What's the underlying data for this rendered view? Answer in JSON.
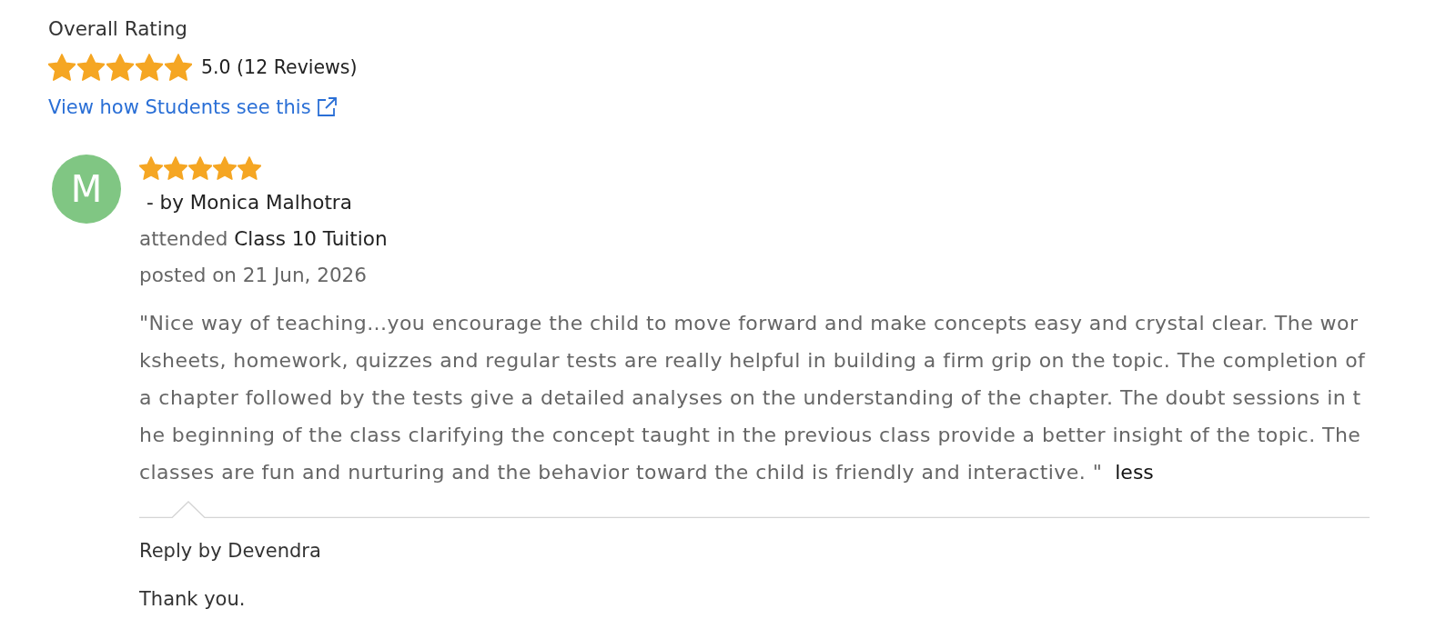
{
  "overall": {
    "heading": "Overall Rating",
    "stars": 5,
    "score": "5.0 (12 Reviews)",
    "link": "View how Students see this"
  },
  "reviews": [
    {
      "initial": "M",
      "stars": 5,
      "author": "- by Monica Malhotra",
      "attended_label": "attended",
      "course": "Class 10 Tuition",
      "posted": "posted on 21 Jun, 2026",
      "text": "\"Nice way of teaching...you encourage the child to move forward and make concepts easy and crystal clear. The worksheets, homework, quizzes and regular tests are really helpful in building a firm grip on the topic. The completion of a chapter followed by the tests give a detailed analyses on the understanding of the chapter. The doubt sessions in the beginning of the class clarifying the concept taught in the previous class provide a better insight of the topic. The classes are fun and nurturing and the behavior toward the child is friendly and interactive. \"",
      "toggle": "less",
      "reply": {
        "title": "Reply by Devendra",
        "text": "Thank you."
      }
    }
  ]
}
